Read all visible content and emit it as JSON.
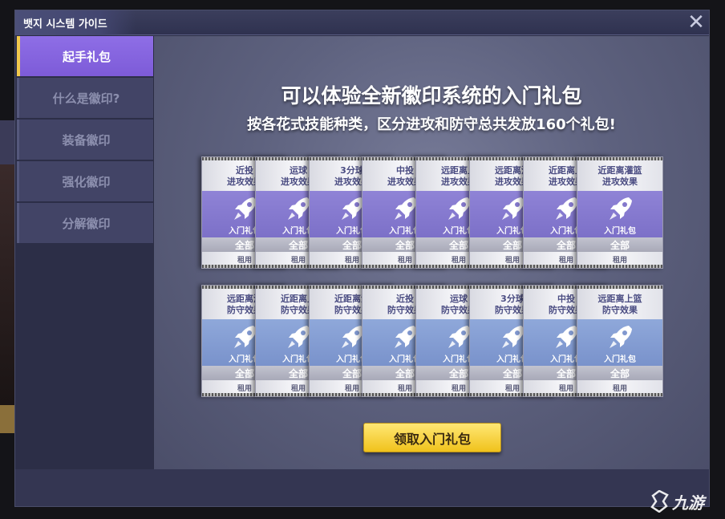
{
  "window": {
    "title": "뱃지 시스템 가이드",
    "close_glyph": "✕"
  },
  "sidebar": {
    "items": [
      {
        "label": "起手礼包",
        "active": true
      },
      {
        "label": "什么是徽印?",
        "active": false
      },
      {
        "label": "装备徽印",
        "active": false
      },
      {
        "label": "强化徽印",
        "active": false
      },
      {
        "label": "分解徽印",
        "active": false
      }
    ]
  },
  "main": {
    "headline": "可以体验全新徽印系统的入门礼包",
    "subline": "按各花式技能种类，区分进攻和防守总共发放160个礼包!",
    "card_kit_label": "入门礼包",
    "card_all_label": "全部",
    "card_rent_label": "租用",
    "attack_cards": [
      {
        "title1": "近投",
        "title2": "进攻效果"
      },
      {
        "title1": "运球",
        "title2": "进攻效果"
      },
      {
        "title1": "3分球",
        "title2": "进攻效果"
      },
      {
        "title1": "中投",
        "title2": "进攻效果"
      },
      {
        "title1": "远距离上",
        "title2": "进攻效果"
      },
      {
        "title1": "远距离灌",
        "title2": "进攻效果"
      },
      {
        "title1": "近距离上",
        "title2": "进攻效果"
      },
      {
        "title1": "近距离灌篮",
        "title2": "进攻效果"
      }
    ],
    "defense_cards": [
      {
        "title1": "远距离灌",
        "title2": "防守效果"
      },
      {
        "title1": "近距离上",
        "title2": "防守效果"
      },
      {
        "title1": "近距离灌",
        "title2": "防守效果"
      },
      {
        "title1": "近投",
        "title2": "防守效果"
      },
      {
        "title1": "运球",
        "title2": "防守效果"
      },
      {
        "title1": "3分球",
        "title2": "防守效果"
      },
      {
        "title1": "中投",
        "title2": "防守效果"
      },
      {
        "title1": "远距离上篮",
        "title2": "防守效果"
      }
    ],
    "claim_button": "领取入门礼包"
  },
  "watermark": {
    "text": "九游"
  },
  "colors": {
    "accent_active": "#8e6ee6",
    "button_yellow": "#f0c21c",
    "attack_band": "#8f83d6",
    "defense_band": "#8fa8da"
  },
  "icons": {
    "close": "close-icon",
    "card": "rocket-icon",
    "watermark": "jiuyou-logo-icon"
  }
}
